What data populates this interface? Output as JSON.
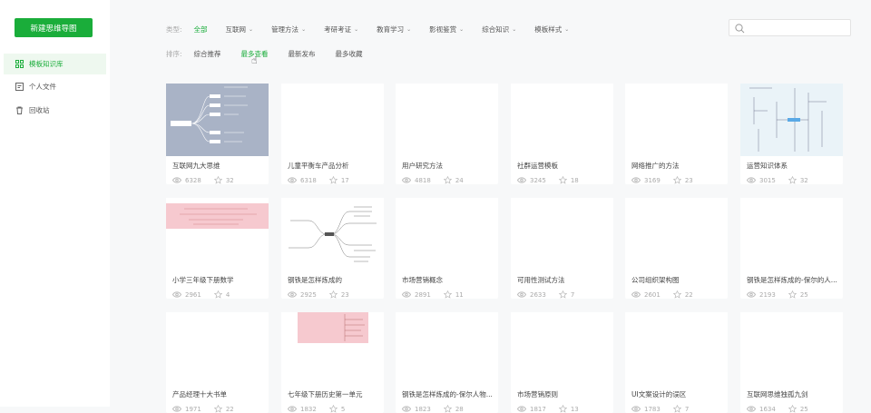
{
  "sidebar": {
    "new_button": "新建思维导图",
    "items": [
      {
        "label": "模板知识库",
        "icon": "template-grid-icon",
        "active": true
      },
      {
        "label": "个人文件",
        "icon": "file-icon"
      },
      {
        "label": "回收站",
        "icon": "trash-icon"
      }
    ]
  },
  "filters": {
    "type_label": "类型:",
    "types": [
      {
        "label": "全部",
        "active": true,
        "dropdown": false
      },
      {
        "label": "互联网",
        "dropdown": true
      },
      {
        "label": "管理方法",
        "dropdown": true
      },
      {
        "label": "考研考证",
        "dropdown": true
      },
      {
        "label": "教育学习",
        "dropdown": true
      },
      {
        "label": "影视鉴赏",
        "dropdown": true
      },
      {
        "label": "综合知识",
        "dropdown": true
      },
      {
        "label": "模板样式",
        "dropdown": true
      }
    ],
    "sort_label": "排序:",
    "sorts": [
      {
        "label": "综合推荐"
      },
      {
        "label": "最多查看",
        "active": true
      },
      {
        "label": "最新发布"
      },
      {
        "label": "最多收藏"
      }
    ]
  },
  "search": {
    "placeholder": ""
  },
  "colors": {
    "accent": "#1aad3a"
  },
  "cards": [
    {
      "title": "互联网九大思维",
      "views": "6328",
      "stars": "32",
      "thumb": "gray"
    },
    {
      "title": "儿童平衡车产品分析",
      "views": "6318",
      "stars": "17",
      "thumb": "blank"
    },
    {
      "title": "用户研究方法",
      "views": "4818",
      "stars": "24",
      "thumb": "blank"
    },
    {
      "title": "社群运营模板",
      "views": "3245",
      "stars": "18",
      "thumb": "blank"
    },
    {
      "title": "网络推广的方法",
      "views": "3169",
      "stars": "23",
      "thumb": "blank"
    },
    {
      "title": "运营知识体系",
      "views": "3015",
      "stars": "32",
      "thumb": "blue"
    },
    {
      "title": "小学三年级下册数学",
      "views": "2961",
      "stars": "4",
      "thumb": "pink"
    },
    {
      "title": "钢铁是怎样炼成的",
      "views": "2925",
      "stars": "23",
      "thumb": "map"
    },
    {
      "title": "市场营销概念",
      "views": "2891",
      "stars": "11",
      "thumb": "blank"
    },
    {
      "title": "可用性测试方法",
      "views": "2633",
      "stars": "7",
      "thumb": "blank"
    },
    {
      "title": "公司组织架构图",
      "views": "2601",
      "stars": "22",
      "thumb": "blank"
    },
    {
      "title": "钢铁是怎样炼成的-保尔的人...",
      "views": "2193",
      "stars": "25",
      "thumb": "blank"
    },
    {
      "title": "产品经理十大书单",
      "views": "1971",
      "stars": "22",
      "thumb": "blank"
    },
    {
      "title": "七年级下册历史第一单元",
      "views": "1832",
      "stars": "5",
      "thumb": "pinkstrip"
    },
    {
      "title": "钢铁是怎样炼成的-保尔人物...",
      "views": "1823",
      "stars": "28",
      "thumb": "blank"
    },
    {
      "title": "市场营销原则",
      "views": "1817",
      "stars": "13",
      "thumb": "blank"
    },
    {
      "title": "UI文案设计的误区",
      "views": "1783",
      "stars": "7",
      "thumb": "blank"
    },
    {
      "title": "互联网思维独孤九剑",
      "views": "1634",
      "stars": "25",
      "thumb": "blank"
    }
  ]
}
